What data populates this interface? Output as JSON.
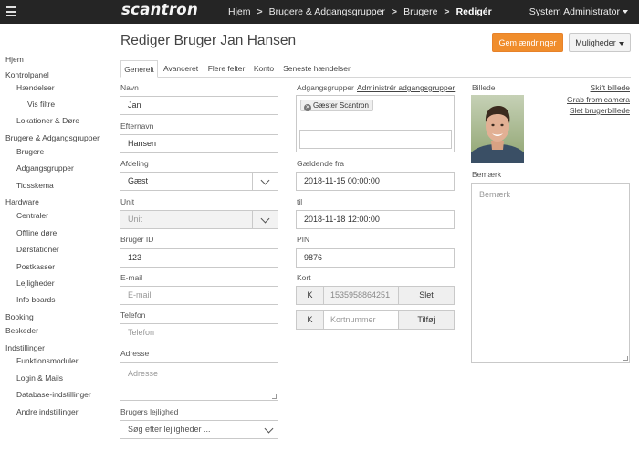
{
  "topbar": {
    "logo": "scantron",
    "breadcrumbs": [
      "Hjem",
      "Brugere & Adgangsgrupper",
      "Brugere",
      "Redigér"
    ],
    "user": "System Administrator"
  },
  "sidebar": {
    "items": [
      {
        "label": "Hjem"
      },
      {
        "label": "Kontrolpanel"
      },
      {
        "label": "Hændelser"
      },
      {
        "label": "Vis filtre"
      },
      {
        "label": "Lokationer & Døre"
      },
      {
        "label": "Brugere & Adgangsgrupper"
      },
      {
        "label": "Brugere"
      },
      {
        "label": "Adgangsgrupper"
      },
      {
        "label": "Tidsskema"
      },
      {
        "label": "Hardware"
      },
      {
        "label": "Centraler"
      },
      {
        "label": "Offline døre"
      },
      {
        "label": "Dørstationer"
      },
      {
        "label": "Postkasser"
      },
      {
        "label": "Lejligheder"
      },
      {
        "label": "Info boards"
      },
      {
        "label": "Booking"
      },
      {
        "label": "Beskeder"
      },
      {
        "label": "Indstillinger"
      },
      {
        "label": "Funktionsmoduler"
      },
      {
        "label": "Login & Mails"
      },
      {
        "label": "Database-indstillinger"
      },
      {
        "label": "Andre indstillinger"
      }
    ]
  },
  "page": {
    "title": "Rediger Bruger Jan Hansen",
    "save_label": "Gem ændringer",
    "options_label": "Muligheder"
  },
  "tabs": [
    "Generelt",
    "Avanceret",
    "Flere felter",
    "Konto",
    "Seneste hændelser"
  ],
  "form": {
    "navn": {
      "label": "Navn",
      "value": "Jan"
    },
    "efternavn": {
      "label": "Efternavn",
      "value": "Hansen"
    },
    "afdeling": {
      "label": "Afdeling",
      "value": "Gæst"
    },
    "unit": {
      "label": "Unit",
      "placeholder": "Unit"
    },
    "bruger_id": {
      "label": "Bruger ID",
      "value": "123"
    },
    "email": {
      "label": "E-mail",
      "placeholder": "E-mail"
    },
    "telefon": {
      "label": "Telefon",
      "placeholder": "Telefon"
    },
    "adresse": {
      "label": "Adresse",
      "placeholder": "Adresse"
    },
    "lejlighed": {
      "label": "Brugers lejlighed",
      "placeholder": "Søg efter lejligheder ..."
    }
  },
  "access": {
    "groups_label": "Adgangsgrupper",
    "admin_link": "Administrér adgangsgrupper",
    "group_tag": "Gæster Scantron",
    "valid_from_label": "Gældende fra",
    "valid_from": "2018-11-15 00:00:00",
    "til_label": "til",
    "til": "2018-11-18 12:00:00",
    "pin_label": "PIN",
    "pin": "9876",
    "kort_label": "Kort",
    "card_prefix": "K",
    "card_number": "1535958864251",
    "delete_label": "Slet",
    "card_placeholder": "Kortnummer",
    "add_label": "Tilføj"
  },
  "picture": {
    "label": "Billede",
    "change_link": "Skift billede",
    "camera_link": "Grab from camera",
    "delete_link": "Slet brugerbillede"
  },
  "note": {
    "label": "Bemærk",
    "placeholder": "Bemærk"
  }
}
